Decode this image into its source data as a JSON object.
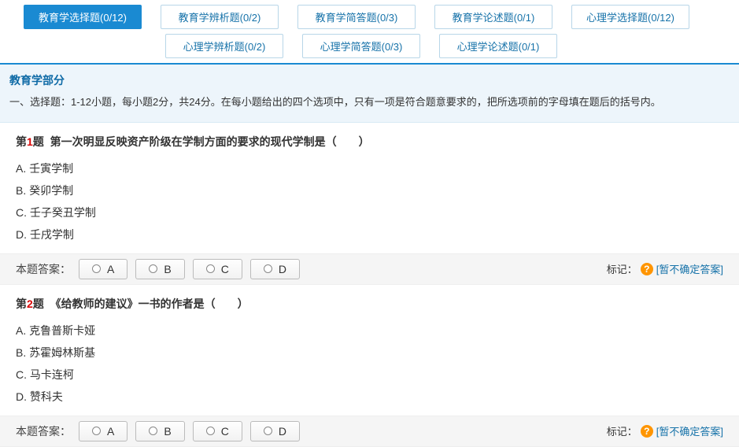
{
  "tabs": {
    "row1": [
      {
        "label": "教育学选择题(0/12)",
        "active": true
      },
      {
        "label": "教育学辨析题(0/2)",
        "active": false
      },
      {
        "label": "教育学简答题(0/3)",
        "active": false
      },
      {
        "label": "教育学论述题(0/1)",
        "active": false
      },
      {
        "label": "心理学选择题(0/12)",
        "active": false
      }
    ],
    "row2": [
      {
        "label": "心理学辨析题(0/2)"
      },
      {
        "label": "心理学简答题(0/3)"
      },
      {
        "label": "心理学论述题(0/1)"
      }
    ]
  },
  "section": {
    "title": "教育学部分",
    "desc": "一、选择题：1-12小题，每小题2分，共24分。在每小题给出的四个选项中，只有一项是符合题意要求的，把所选项前的字母填在题后的括号内。"
  },
  "questions": [
    {
      "num_prefix": "第",
      "num": "1",
      "num_suffix": "题",
      "stem": "第一次明显反映资产阶级在学制方面的要求的现代学制是（　　）",
      "options": [
        "A. 壬寅学制",
        "B. 癸卯学制",
        "C. 壬子癸丑学制",
        "D. 壬戌学制"
      ]
    },
    {
      "num_prefix": "第",
      "num": "2",
      "num_suffix": "题",
      "stem": "《给教师的建议》一书的作者是（　　）",
      "options": [
        "A. 克鲁普斯卡娅",
        "B. 苏霍姆林斯基",
        "C. 马卡连柯",
        "D. 赞科夫"
      ]
    }
  ],
  "answer_bar": {
    "label": "本题答案：",
    "choices": [
      "A",
      "B",
      "C",
      "D"
    ],
    "mark_label": "标记：",
    "uncertain": "[暂不确定答案]"
  }
}
